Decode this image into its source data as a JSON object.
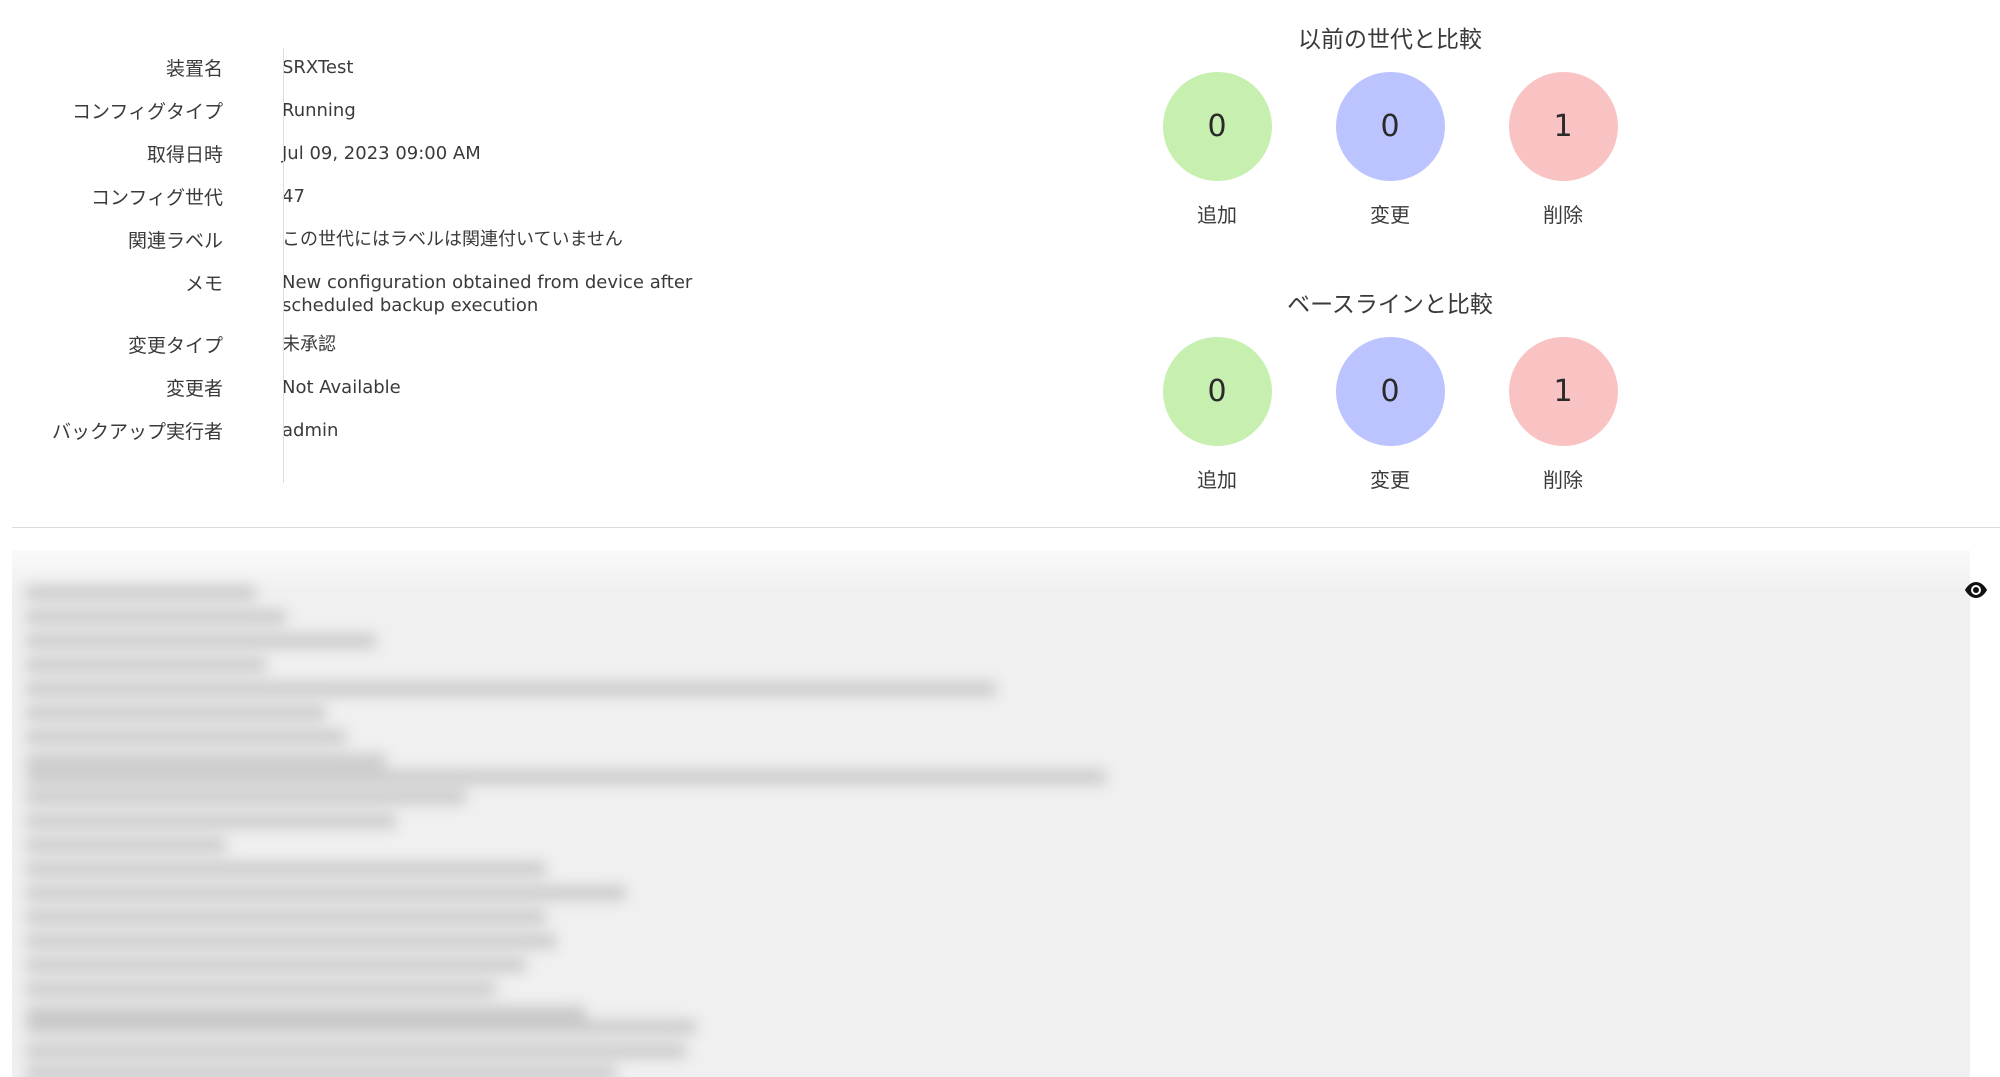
{
  "details": [
    {
      "label": "装置名",
      "value": "SRXTest"
    },
    {
      "label": "コンフィグタイプ",
      "value": "Running"
    },
    {
      "label": "取得日時",
      "value": "Jul 09, 2023 09:00 AM"
    },
    {
      "label": "コンフィグ世代",
      "value": "47"
    },
    {
      "label": "関連ラベル",
      "value": "この世代にはラベルは関連付いていません"
    },
    {
      "label": "メモ",
      "value": "New configuration obtained from device after scheduled backup execution"
    },
    {
      "label": "変更タイプ",
      "value": "未承認"
    },
    {
      "label": "変更者",
      "value": "Not Available"
    },
    {
      "label": "バックアップ実行者",
      "value": "admin"
    }
  ],
  "compare_previous": {
    "title": "以前の世代と比較",
    "added": {
      "count": "0",
      "label": "追加"
    },
    "modified": {
      "count": "0",
      "label": "変更"
    },
    "deleted": {
      "count": "1",
      "label": "削除"
    }
  },
  "compare_baseline": {
    "title": "ベースラインと比較",
    "added": {
      "count": "0",
      "label": "追加"
    },
    "modified": {
      "count": "0",
      "label": "変更"
    },
    "deleted": {
      "count": "1",
      "label": "削除"
    }
  },
  "colors": {
    "added": "#c6efb0",
    "modified": "#bcc4ff",
    "deleted": "#f9c3c3"
  },
  "icons": {
    "toggle_view": "eye-icon"
  }
}
